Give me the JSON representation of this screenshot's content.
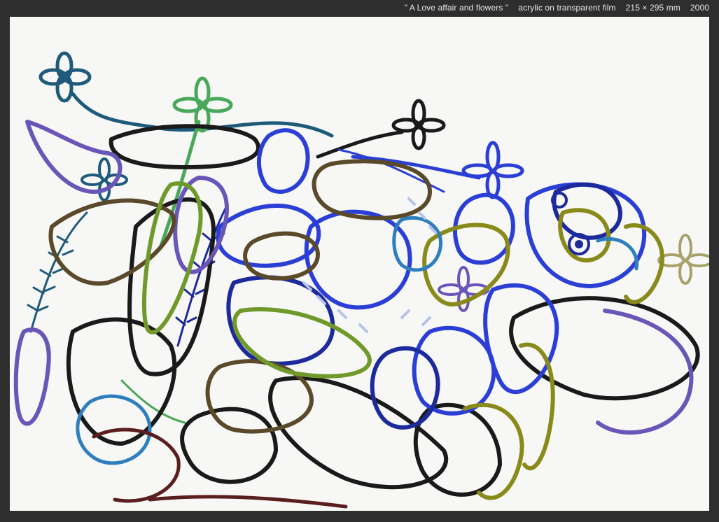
{
  "caption": {
    "title": "\" A Love affair and flowers \"",
    "medium": "acrylic on transparent film",
    "size": "215 × 295 mm",
    "year": "2000"
  },
  "colors": {
    "frame": "#2e2e2e",
    "paper": "#f7f7f5",
    "caption_text": "#e6e6e6",
    "palette": [
      "#1a1a1a",
      "#2b3fd6",
      "#1d2a9c",
      "#6a55b8",
      "#2f7fbf",
      "#1e5a7a",
      "#5a4a2a",
      "#8a8a1a",
      "#6f9a2a",
      "#4aa85a",
      "#5a1e1e",
      "#b7c3ec"
    ]
  }
}
